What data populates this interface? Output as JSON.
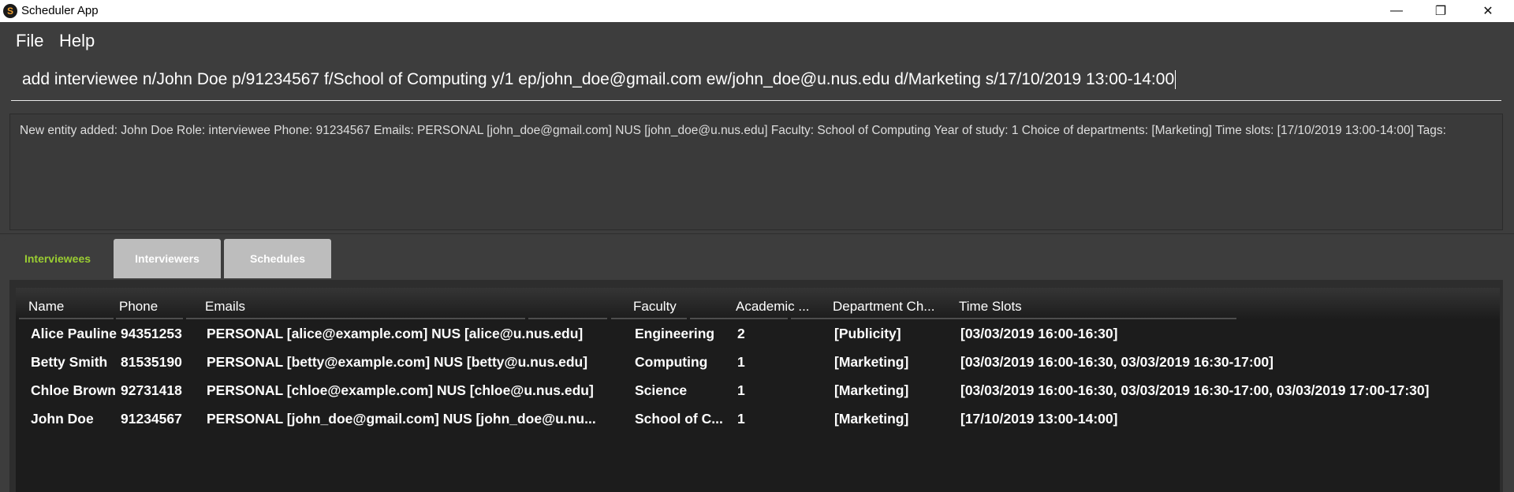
{
  "window": {
    "title": "Scheduler App",
    "icon_letter": "S",
    "minimize": "—",
    "restore": "❐",
    "close": "✕"
  },
  "menu": {
    "items": [
      "File",
      "Help"
    ]
  },
  "command": {
    "value": "add interviewee n/John Doe p/91234567 f/School of Computing y/1 ep/john_doe@gmail.com ew/john_doe@u.nus.edu d/Marketing s/17/10/2019 13:00-14:00"
  },
  "result": {
    "text": "New entity added: John Doe Role: interviewee Phone: 91234567 Emails: PERSONAL [john_doe@gmail.com] NUS [john_doe@u.nus.edu] Faculty: School of Computing Year of study: 1 Choice of departments: [Marketing] Time slots: [17/10/2019 13:00-14:00] Tags:"
  },
  "tabs": [
    {
      "label": "Interviewees",
      "active": true
    },
    {
      "label": "Interviewers",
      "active": false
    },
    {
      "label": "Schedules",
      "active": false
    }
  ],
  "table": {
    "headers": [
      "Name",
      "Phone",
      "Emails",
      "Faculty",
      "Academic ...",
      "Department Ch...",
      "Time Slots"
    ],
    "rows": [
      [
        "Alice Pauline",
        "94351253",
        "PERSONAL [alice@example.com] NUS [alice@u.nus.edu]",
        "Engineering",
        "2",
        "[Publicity]",
        "[03/03/2019 16:00-16:30]"
      ],
      [
        "Betty Smith",
        "81535190",
        "PERSONAL [betty@example.com] NUS [betty@u.nus.edu]",
        "Computing",
        "1",
        "[Marketing]",
        "[03/03/2019 16:00-16:30, 03/03/2019 16:30-17:00]"
      ],
      [
        "Chloe Brown",
        "92731418",
        "PERSONAL [chloe@example.com] NUS [chloe@u.nus.edu]",
        "Science",
        "1",
        "[Marketing]",
        "[03/03/2019 16:00-16:30, 03/03/2019 16:30-17:00, 03/03/2019 17:00-17:30]"
      ],
      [
        "John Doe",
        "91234567",
        "PERSONAL [john_doe@gmail.com] NUS [john_doe@u.nu...",
        "School of C...",
        "1",
        "[Marketing]",
        "[17/10/2019 13:00-14:00]"
      ]
    ]
  },
  "colors": {
    "background": "#3d3d3d",
    "active_tab": "#9acd32",
    "table_bg": "#1c1c1c"
  }
}
